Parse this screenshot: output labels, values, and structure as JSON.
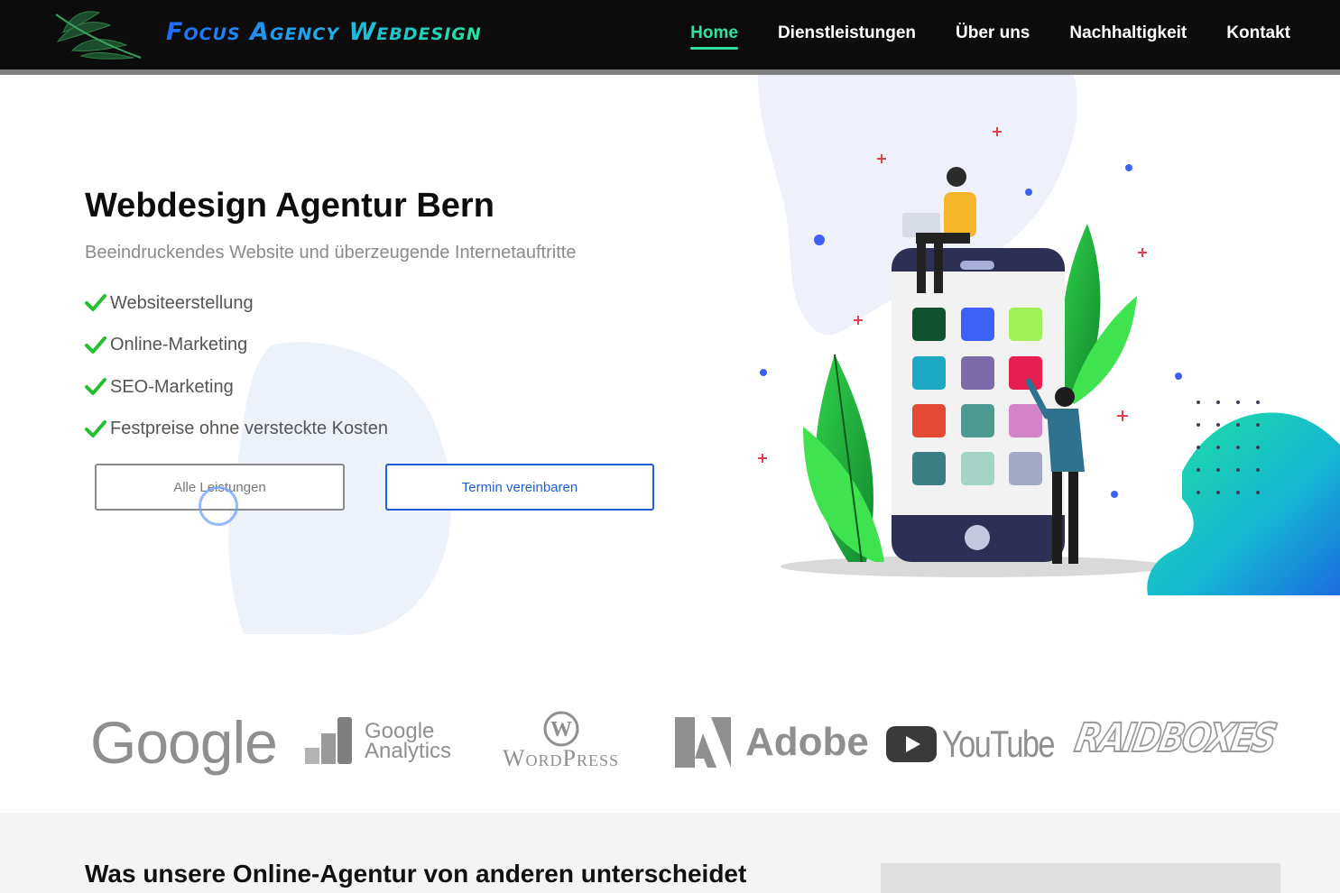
{
  "header": {
    "logo_text": "Focus Agency Webdesign",
    "nav": [
      {
        "label": "Home",
        "active": true
      },
      {
        "label": "Dienstleistungen",
        "active": false
      },
      {
        "label": "Über uns",
        "active": false
      },
      {
        "label": "Nachhaltigkeit",
        "active": false
      },
      {
        "label": "Kontakt",
        "active": false
      }
    ]
  },
  "hero": {
    "title": "Webdesign Agentur Bern",
    "subtitle": "Beeindruckendes Website und überzeugende Internetauftritte",
    "features": [
      "Websiteerstellung",
      "Online-Marketing",
      "SEO-Marketing",
      "Festpreise ohne versteckte Kosten"
    ],
    "buttons": {
      "services": "Alle Leistungen",
      "appointment": "Termin vereinbaren"
    },
    "illustration_icon": "person-with-phone-app-grid-illustration"
  },
  "brands": {
    "google": "Google",
    "google_analytics": [
      "Google",
      "Analytics"
    ],
    "wordpress": "WordPress",
    "adobe": "Adobe",
    "youtube": "YouTube",
    "raidboxes": "RAIDBOXES"
  },
  "section2": {
    "title": "Was unsere Online-Agentur von anderen unterscheidet"
  },
  "colors": {
    "accent_green": "#33e0a0",
    "check_green": "#22c02c",
    "primary_blue": "#1e5fd8",
    "header_bg": "#0c0c0c"
  }
}
